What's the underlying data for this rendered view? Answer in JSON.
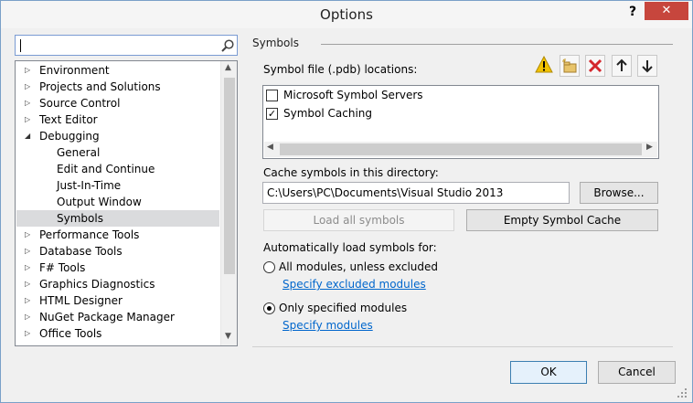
{
  "window": {
    "title": "Options",
    "help": "?",
    "close": "✕"
  },
  "tree": {
    "items": [
      {
        "label": "Environment",
        "expander": "▷"
      },
      {
        "label": "Projects and Solutions",
        "expander": "▷"
      },
      {
        "label": "Source Control",
        "expander": "▷"
      },
      {
        "label": "Text Editor",
        "expander": "▷"
      },
      {
        "label": "Debugging",
        "expander": "◢"
      },
      {
        "label": "General",
        "expander": ""
      },
      {
        "label": "Edit and Continue",
        "expander": ""
      },
      {
        "label": "Just-In-Time",
        "expander": ""
      },
      {
        "label": "Output Window",
        "expander": ""
      },
      {
        "label": "Symbols",
        "expander": "",
        "selected": true
      },
      {
        "label": "Performance Tools",
        "expander": "▷"
      },
      {
        "label": "Database Tools",
        "expander": "▷"
      },
      {
        "label": "F# Tools",
        "expander": "▷"
      },
      {
        "label": "Graphics Diagnostics",
        "expander": "▷"
      },
      {
        "label": "HTML Designer",
        "expander": "▷"
      },
      {
        "label": "NuGet Package Manager",
        "expander": "▷"
      },
      {
        "label": "Office Tools",
        "expander": "▷"
      }
    ]
  },
  "symbols": {
    "group_label": "Symbols",
    "locations_label": "Symbol file (.pdb) locations:",
    "locations": [
      {
        "label": "Microsoft Symbol Servers",
        "checked": false
      },
      {
        "label": "Symbol Caching",
        "checked": true
      }
    ],
    "cache_label": "Cache symbols in this directory:",
    "cache_path": "C:\\Users\\PC\\Documents\\Visual Studio 2013",
    "browse_button": "Browse...",
    "load_all_button": "Load all symbols",
    "empty_cache_button": "Empty Symbol Cache",
    "auto_load_label": "Automatically load symbols for:",
    "radio_all": "All modules, unless excluded",
    "link_excluded": "Specify excluded modules",
    "radio_specified": "Only specified modules",
    "link_specified": "Specify modules",
    "selected_option": "Only specified modules"
  },
  "footer": {
    "ok": "OK",
    "cancel": "Cancel"
  },
  "colors": {
    "accent": "#3c7fb1",
    "link": "#0066cc",
    "close": "#c7463d",
    "warning": "#f2c200",
    "delete": "#d4262c"
  }
}
